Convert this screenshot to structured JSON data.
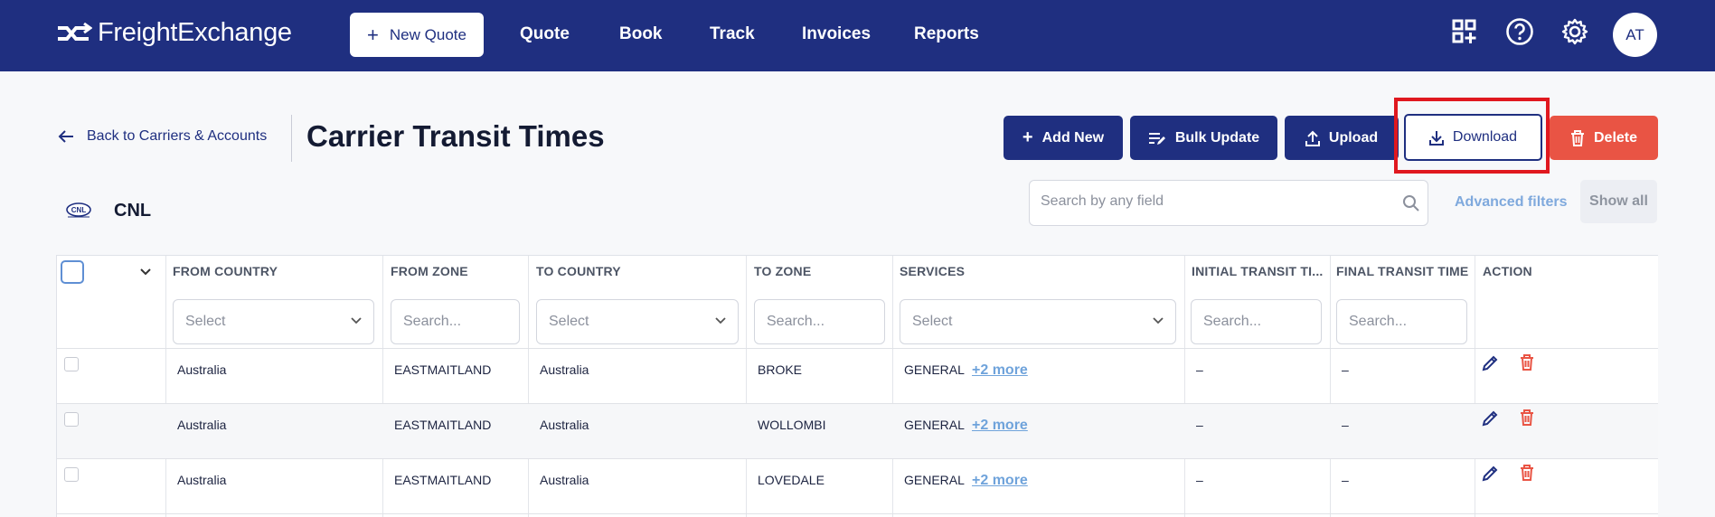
{
  "brand": {
    "name": "FreightExchange"
  },
  "topnav": {
    "new_quote": "New Quote",
    "links": [
      "Quote",
      "Book",
      "Track",
      "Invoices",
      "Reports"
    ],
    "avatar_initials": "AT"
  },
  "header": {
    "back_label": "Back to Carriers & Accounts",
    "title": "Carrier Transit Times",
    "buttons": {
      "add_new": "Add New",
      "bulk_update": "Bulk Update",
      "upload": "Upload",
      "download": "Download",
      "delete": "Delete"
    }
  },
  "carrier": {
    "code": "CNL",
    "logo_text": "CNL"
  },
  "search": {
    "placeholder": "Search by any field"
  },
  "filters_link": "Advanced filters",
  "show_all": "Show all",
  "table": {
    "columns": [
      "FROM COUNTRY",
      "FROM ZONE",
      "TO COUNTRY",
      "TO ZONE",
      "SERVICES",
      "INITIAL TRANSIT TI...",
      "FINAL TRANSIT TIME",
      "ACTION"
    ],
    "filter_placeholders": {
      "select": "Select",
      "search": "Search..."
    },
    "rows": [
      {
        "from_country": "Australia",
        "from_zone": "EASTMAITLAND",
        "to_country": "Australia",
        "to_zone": "BROKE",
        "services": "GENERAL",
        "more": "+2 more",
        "initial": "–",
        "final": "–"
      },
      {
        "from_country": "Australia",
        "from_zone": "EASTMAITLAND",
        "to_country": "Australia",
        "to_zone": "WOLLOMBI",
        "services": "GENERAL",
        "more": "+2 more",
        "initial": "–",
        "final": "–"
      },
      {
        "from_country": "Australia",
        "from_zone": "EASTMAITLAND",
        "to_country": "Australia",
        "to_zone": "LOVEDALE",
        "services": "GENERAL",
        "more": "+2 more",
        "initial": "–",
        "final": "–"
      }
    ]
  },
  "colors": {
    "navy": "#1f2f80",
    "red": "#e95444",
    "highlight": "#e0181f",
    "link": "#6fa3db"
  }
}
